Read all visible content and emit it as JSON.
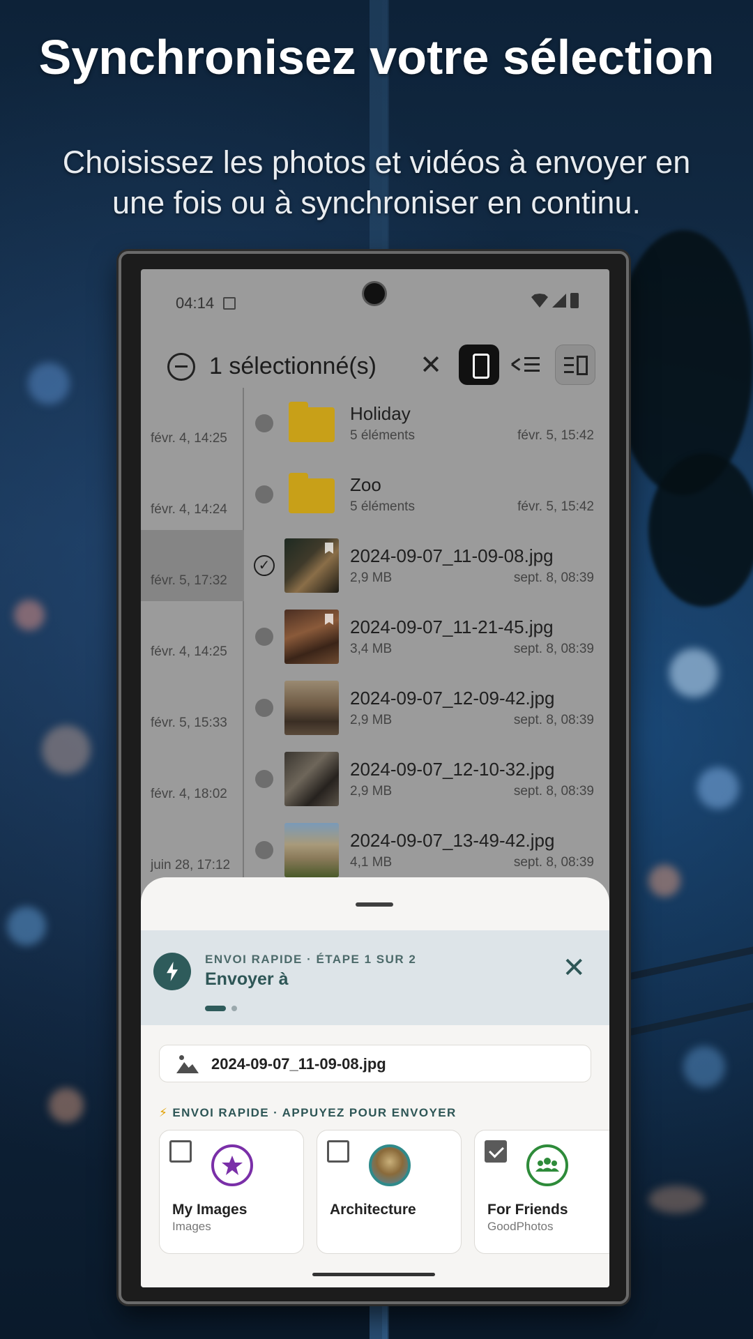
{
  "headline": {
    "title": "Synchronisez votre sélection",
    "subtitle": "Choisissez les photos et vidéos à envoyer en une fois ou à synchroniser en continu."
  },
  "status_bar": {
    "time": "04:14"
  },
  "toolbar": {
    "selection_label": "1 sélectionné(s)",
    "close_glyph": "✕"
  },
  "left_dates": [
    {
      "label": "févr. 4, 14:25"
    },
    {
      "label": "févr. 4, 14:24"
    },
    {
      "label": "févr. 5, 17:32",
      "selected": true
    },
    {
      "label": "févr. 4, 14:25"
    },
    {
      "label": "févr. 5, 15:33"
    },
    {
      "label": "févr. 4, 18:02"
    },
    {
      "label": "juin 28, 17:12"
    }
  ],
  "files": [
    {
      "name": "Holiday",
      "meta": "5 éléments",
      "date": "févr. 5, 15:42",
      "type": "folder"
    },
    {
      "name": "Zoo",
      "meta": "5 éléments",
      "date": "févr. 5, 15:42",
      "type": "folder"
    },
    {
      "name": "2024-09-07_11-09-08.jpg",
      "meta": "2,9 MB",
      "date": "sept. 8, 08:39",
      "type": "image",
      "checked": true
    },
    {
      "name": "2024-09-07_11-21-45.jpg",
      "meta": "3,4 MB",
      "date": "sept. 8, 08:39",
      "type": "image"
    },
    {
      "name": "2024-09-07_12-09-42.jpg",
      "meta": "2,9 MB",
      "date": "sept. 8, 08:39",
      "type": "image"
    },
    {
      "name": "2024-09-07_12-10-32.jpg",
      "meta": "2,9 MB",
      "date": "sept. 8, 08:39",
      "type": "image"
    },
    {
      "name": "2024-09-07_13-49-42.jpg",
      "meta": "4,1 MB",
      "date": "sept. 8, 08:39",
      "type": "image"
    }
  ],
  "sheet": {
    "step_label": "ENVOI RAPIDE · ÉTAPE 1 SUR 2",
    "title": "Envoyer à",
    "close_glyph": "✕",
    "selected_file": "2024-09-07_11-09-08.jpg",
    "quick_zap": "⚡",
    "quick_label": "ENVOI RAPIDE · APPUYEZ POUR ENVOYER",
    "destinations": [
      {
        "name": "My Images",
        "sub": "Images",
        "checked": false,
        "color": "#7a2fa8",
        "icon": "star-icon"
      },
      {
        "name": "Architecture",
        "sub": "",
        "checked": false,
        "color": "#2f8a8a",
        "icon": "cathedral-photo-icon"
      },
      {
        "name": "For Friends",
        "sub": "GoodPhotos",
        "checked": true,
        "color": "#2e8b3a",
        "icon": "group-icon"
      }
    ]
  },
  "colors": {
    "accent": "#2e5b5b",
    "folder": "#c8a018",
    "sheet_header": "#dde4e8"
  }
}
